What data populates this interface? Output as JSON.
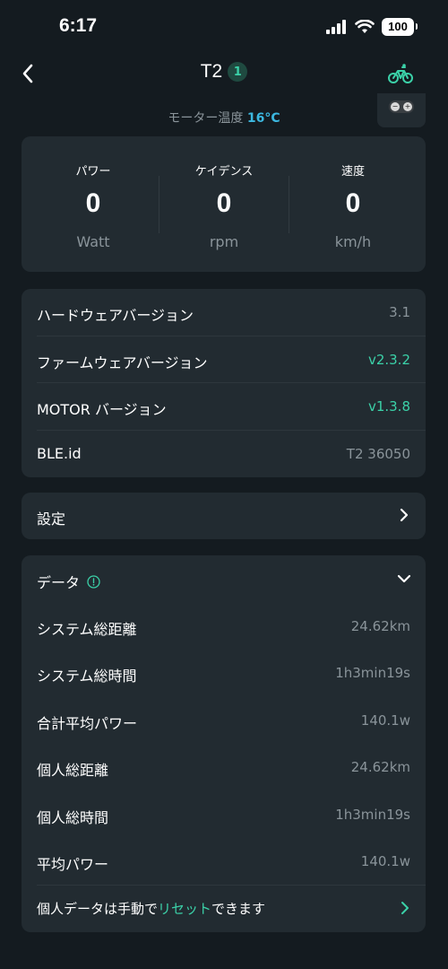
{
  "status_bar": {
    "time": "6:17",
    "battery": "100"
  },
  "nav": {
    "title": "T2",
    "badge": "1"
  },
  "motor_temp": {
    "label": "モーター温度",
    "value": "16°C"
  },
  "metrics": [
    {
      "label": "パワー",
      "value": "0",
      "unit": "Watt"
    },
    {
      "label": "ケイデンス",
      "value": "0",
      "unit": "rpm"
    },
    {
      "label": "速度",
      "value": "0",
      "unit": "km/h"
    }
  ],
  "device_info": [
    {
      "label": "ハードウェアバージョン",
      "value": "3.1"
    },
    {
      "label": "ファームウェアバージョン",
      "value": "v2.3.2"
    },
    {
      "label": "MOTOR バージョン",
      "value": "v1.3.8"
    },
    {
      "label": "BLE.id",
      "value": "T2 36050"
    }
  ],
  "settings": {
    "label": "設定"
  },
  "data_section": {
    "title": "データ",
    "rows": [
      {
        "label": "システム総距離",
        "value": "24.62km"
      },
      {
        "label": "システム総時間",
        "value": "1h3min19s"
      },
      {
        "label": "合計平均パワー",
        "value": "140.1w"
      },
      {
        "label": "個人総距離",
        "value": "24.62km"
      },
      {
        "label": "個人総時間",
        "value": "1h3min19s"
      },
      {
        "label": "平均パワー",
        "value": "140.1w"
      }
    ],
    "reset": {
      "prefix": "個人データは手動で",
      "link": "リセット",
      "suffix": "できます"
    }
  },
  "colors": {
    "background": "#141b20",
    "card": "#222b31",
    "accent": "#3bd1a8",
    "temperature": "#3cb8e0",
    "muted": "#8a949a"
  },
  "icons": [
    "back-arrow-icon",
    "bicycle-icon",
    "info-icon",
    "chevron-right-icon",
    "chevron-down-icon",
    "signal-icon",
    "wifi-icon",
    "battery-icon"
  ]
}
